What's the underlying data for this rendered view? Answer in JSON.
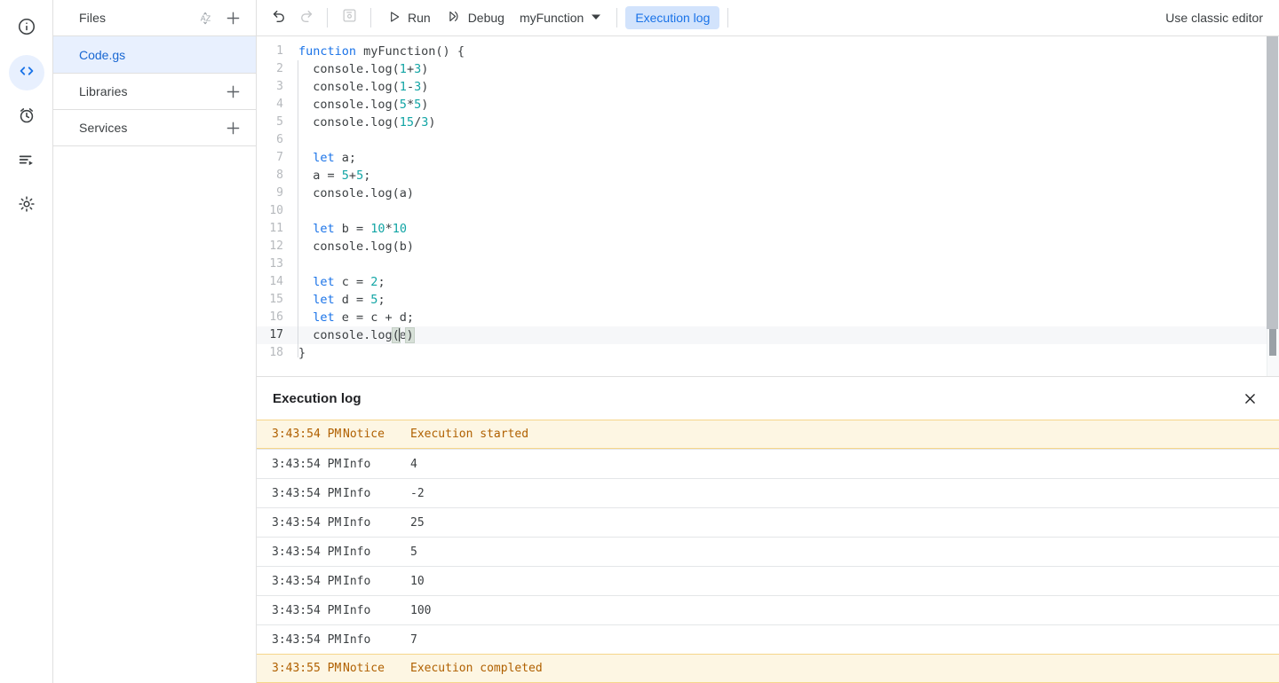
{
  "rail": {
    "items": [
      {
        "name": "project-overview",
        "icon": "info-circle-icon",
        "active": false
      },
      {
        "name": "editor",
        "icon": "code-brackets-icon",
        "active": true
      },
      {
        "name": "triggers",
        "icon": "alarm-clock-icon",
        "active": false
      },
      {
        "name": "executions",
        "icon": "executions-list-icon",
        "active": false
      },
      {
        "name": "project-settings",
        "icon": "gear-icon",
        "active": false
      }
    ]
  },
  "sidebar": {
    "files": {
      "title": "Files",
      "sort_icon": "sort-az-icon",
      "add_icon": "plus-icon",
      "items": [
        {
          "label": "Code.gs",
          "selected": true
        }
      ]
    },
    "libraries": {
      "title": "Libraries",
      "add_icon": "plus-icon"
    },
    "services": {
      "title": "Services",
      "add_icon": "plus-icon"
    }
  },
  "toolbar": {
    "undo_icon": "undo-icon",
    "redo_icon": "redo-icon",
    "save_icon": "save-floppy-icon",
    "run_label": "Run",
    "run_icon": "play-triangle-icon",
    "debug_label": "Debug",
    "debug_icon": "debug-step-icon",
    "function_select": "myFunction",
    "function_caret_icon": "chevron-down-icon",
    "execution_log_label": "Execution log",
    "classic_editor_label": "Use classic editor"
  },
  "editor": {
    "filename": "Code.gs",
    "active_line": 17,
    "lines": [
      {
        "n": 1,
        "tokens": [
          {
            "t": "function ",
            "c": "kw"
          },
          {
            "t": "myFunction() {",
            "c": ""
          }
        ]
      },
      {
        "n": 2,
        "tokens": [
          {
            "t": "  console.log(",
            "c": ""
          },
          {
            "t": "1",
            "c": "numc"
          },
          {
            "t": "+",
            "c": ""
          },
          {
            "t": "3",
            "c": "numc"
          },
          {
            "t": ")",
            "c": ""
          }
        ]
      },
      {
        "n": 3,
        "tokens": [
          {
            "t": "  console.log(",
            "c": ""
          },
          {
            "t": "1",
            "c": "numc"
          },
          {
            "t": "-",
            "c": ""
          },
          {
            "t": "3",
            "c": "numc"
          },
          {
            "t": ")",
            "c": ""
          }
        ]
      },
      {
        "n": 4,
        "tokens": [
          {
            "t": "  console.log(",
            "c": ""
          },
          {
            "t": "5",
            "c": "numc"
          },
          {
            "t": "*",
            "c": ""
          },
          {
            "t": "5",
            "c": "numc"
          },
          {
            "t": ")",
            "c": ""
          }
        ]
      },
      {
        "n": 5,
        "tokens": [
          {
            "t": "  console.log(",
            "c": ""
          },
          {
            "t": "15",
            "c": "numc"
          },
          {
            "t": "/",
            "c": ""
          },
          {
            "t": "3",
            "c": "numc"
          },
          {
            "t": ")",
            "c": ""
          }
        ]
      },
      {
        "n": 6,
        "tokens": []
      },
      {
        "n": 7,
        "tokens": [
          {
            "t": "  ",
            "c": ""
          },
          {
            "t": "let",
            "c": "kw"
          },
          {
            "t": " a;",
            "c": ""
          }
        ]
      },
      {
        "n": 8,
        "tokens": [
          {
            "t": "  a = ",
            "c": ""
          },
          {
            "t": "5",
            "c": "numc"
          },
          {
            "t": "+",
            "c": ""
          },
          {
            "t": "5",
            "c": "numc"
          },
          {
            "t": ";",
            "c": ""
          }
        ]
      },
      {
        "n": 9,
        "tokens": [
          {
            "t": "  console.log(a)",
            "c": ""
          }
        ]
      },
      {
        "n": 10,
        "tokens": []
      },
      {
        "n": 11,
        "tokens": [
          {
            "t": "  ",
            "c": ""
          },
          {
            "t": "let",
            "c": "kw"
          },
          {
            "t": " b = ",
            "c": ""
          },
          {
            "t": "10",
            "c": "numc"
          },
          {
            "t": "*",
            "c": ""
          },
          {
            "t": "10",
            "c": "numc"
          }
        ]
      },
      {
        "n": 12,
        "tokens": [
          {
            "t": "  console.log(b)",
            "c": ""
          }
        ]
      },
      {
        "n": 13,
        "tokens": []
      },
      {
        "n": 14,
        "tokens": [
          {
            "t": "  ",
            "c": ""
          },
          {
            "t": "let",
            "c": "kw"
          },
          {
            "t": " c = ",
            "c": ""
          },
          {
            "t": "2",
            "c": "numc"
          },
          {
            "t": ";",
            "c": ""
          }
        ]
      },
      {
        "n": 15,
        "tokens": [
          {
            "t": "  ",
            "c": ""
          },
          {
            "t": "let",
            "c": "kw"
          },
          {
            "t": " d = ",
            "c": ""
          },
          {
            "t": "5",
            "c": "numc"
          },
          {
            "t": ";",
            "c": ""
          }
        ]
      },
      {
        "n": 16,
        "tokens": [
          {
            "t": "  ",
            "c": ""
          },
          {
            "t": "let",
            "c": "kw"
          },
          {
            "t": " e = c + d;",
            "c": ""
          }
        ]
      },
      {
        "n": 17,
        "tokens": [
          {
            "t": "  console.log",
            "c": ""
          },
          {
            "t": "(",
            "c": "brk"
          },
          {
            "t": "CARET",
            "c": "caret"
          },
          {
            "t": "e",
            "c": ""
          },
          {
            "t": ")",
            "c": "brk"
          }
        ]
      },
      {
        "n": 18,
        "tokens": [
          {
            "t": "}",
            "c": ""
          }
        ]
      }
    ]
  },
  "execution_log": {
    "title": "Execution log",
    "close_icon": "close-x-icon",
    "columns": [
      "time",
      "severity",
      "message"
    ],
    "rows": [
      {
        "time": "3:43:54 PM",
        "severity": "Notice",
        "message": "Execution started",
        "kind": "notice"
      },
      {
        "time": "3:43:54 PM",
        "severity": "Info",
        "message": "4",
        "kind": "info"
      },
      {
        "time": "3:43:54 PM",
        "severity": "Info",
        "message": "-2",
        "kind": "info"
      },
      {
        "time": "3:43:54 PM",
        "severity": "Info",
        "message": "25",
        "kind": "info"
      },
      {
        "time": "3:43:54 PM",
        "severity": "Info",
        "message": "5",
        "kind": "info"
      },
      {
        "time": "3:43:54 PM",
        "severity": "Info",
        "message": "10",
        "kind": "info"
      },
      {
        "time": "3:43:54 PM",
        "severity": "Info",
        "message": "100",
        "kind": "info"
      },
      {
        "time": "3:43:54 PM",
        "severity": "Info",
        "message": "7",
        "kind": "info"
      },
      {
        "time": "3:43:55 PM",
        "severity": "Notice",
        "message": "Execution completed",
        "kind": "notice"
      }
    ]
  },
  "colors": {
    "accent_blue": "#1a73e8",
    "selected_bg": "#e8f0fe",
    "pill_bg": "#d2e3fc",
    "notice_bg": "#fdf6e3",
    "notice_text": "#b06000",
    "keyword": "#1a73e8",
    "number": "#12a5a5"
  }
}
